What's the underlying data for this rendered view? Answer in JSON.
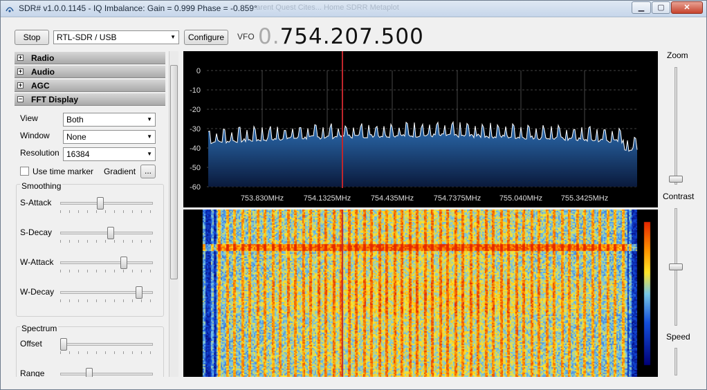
{
  "window": {
    "title": "SDR# v1.0.0.1145 - IQ Imbalance: Gain = 0.999 Phase = -0.859°",
    "background_tabs": "...arent Quest Cites...    Home    SDRR Metaplot"
  },
  "toolbar": {
    "stop_label": "Stop",
    "device": "RTL-SDR / USB",
    "configure_label": "Configure",
    "vfo_label": "VFO",
    "vfo_prefix": "0.",
    "vfo_value": "754.207.500"
  },
  "sidebar": {
    "sections": [
      {
        "label": "Radio",
        "state": "+"
      },
      {
        "label": "Audio",
        "state": "+"
      },
      {
        "label": "AGC",
        "state": "+"
      },
      {
        "label": "FFT Display",
        "state": "−"
      }
    ],
    "fft": {
      "view_label": "View",
      "view_value": "Both",
      "window_label": "Window",
      "window_value": "None",
      "resolution_label": "Resolution",
      "resolution_value": "16384",
      "time_marker_label": "Use time marker",
      "time_marker_checked": false,
      "gradient_label": "Gradient",
      "gradient_button": "...",
      "smoothing_title": "Smoothing",
      "sliders": [
        {
          "label": "S-Attack",
          "level": 0.43
        },
        {
          "label": "S-Decay",
          "level": 0.55
        },
        {
          "label": "W-Attack",
          "level": 0.7
        },
        {
          "label": "W-Decay",
          "level": 0.88
        }
      ],
      "spectrum_title": "Spectrum",
      "spectrum_sliders": [
        {
          "label": "Offset",
          "level": 0.0
        },
        {
          "label": "Range",
          "level": 0.3
        }
      ]
    }
  },
  "spectrum": {
    "y_ticks": [
      "0",
      "-10",
      "-20",
      "-30",
      "-40",
      "-50",
      "-60"
    ],
    "x_ticks": [
      "753.830MHz",
      "754.1325MHz",
      "754.435MHz",
      "754.7375MHz",
      "755.040MHz",
      "755.3425MHz"
    ],
    "colors": {
      "fill_top": "#2d6fb4",
      "fill_bottom": "#0a1a3c",
      "trace": "#ffffff",
      "marker": "#c0262c",
      "grid": "#5a5a5a"
    }
  },
  "right_panel": {
    "zoom_label": "Zoom",
    "zoom_level": 0.0,
    "contrast_label": "Contrast",
    "contrast_level": 0.5,
    "speed_label": "Speed"
  }
}
